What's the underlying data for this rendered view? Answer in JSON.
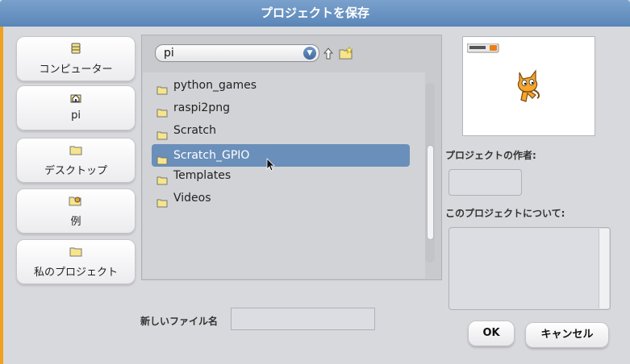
{
  "window": {
    "title": "プロジェクトを保存"
  },
  "locations": [
    {
      "label": "コンピューター",
      "icon": "computer-icon"
    },
    {
      "label": "pi",
      "icon": "home-icon"
    },
    {
      "label": "デスクトップ",
      "icon": "folder-icon"
    },
    {
      "label": "例",
      "icon": "examples-icon"
    },
    {
      "label": "私のプロジェクト",
      "icon": "folder-icon"
    }
  ],
  "browser": {
    "path": "pi",
    "files": [
      "python_games",
      "raspi2png",
      "Scratch",
      "Scratch_GPIO",
      "Templates",
      "Videos"
    ],
    "selected_index": 3
  },
  "info": {
    "author_label": "プロジェクトの作者:",
    "author_value": "",
    "about_label": "このプロジェクトについて:",
    "about_value": ""
  },
  "footer": {
    "filename_label": "新しいファイル名",
    "filename_value": "",
    "ok_label": "OK",
    "cancel_label": "キャンセル"
  },
  "colors": {
    "title_bar": "#6a92c2",
    "selection": "#6a8fba",
    "folder": "#f7e58b"
  }
}
